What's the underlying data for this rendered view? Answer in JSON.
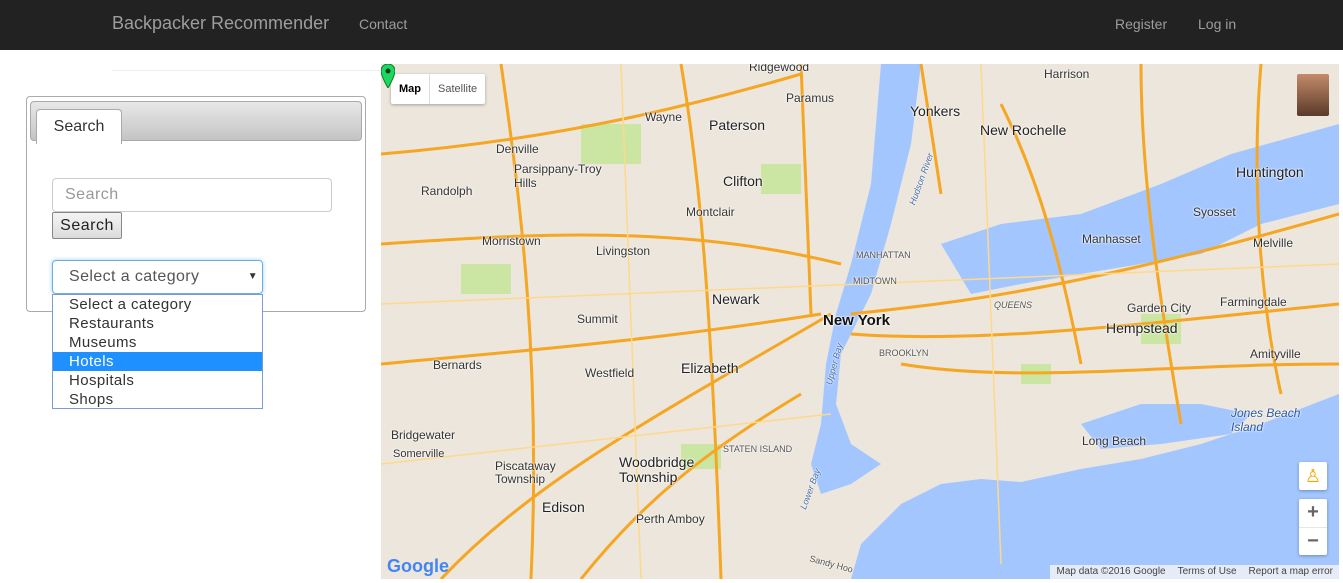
{
  "navbar": {
    "brand": "Backpacker Recommender",
    "contact": "Contact",
    "register": "Register",
    "login": "Log in"
  },
  "sidebar": {
    "tab_label": "Search",
    "search_placeholder": "Search",
    "search_button": "Search",
    "select_value": "Select a category",
    "category_options": [
      "Select a category",
      "Restaurants",
      "Museums",
      "Hotels",
      "Hospitals",
      "Shops"
    ],
    "highlighted_option": "Hotels"
  },
  "map": {
    "type_map": "Map",
    "type_satellite": "Satellite",
    "logo": "Google",
    "footer": {
      "data": "Map data ©2016 Google",
      "terms": "Terms of Use",
      "report": "Report a map error"
    },
    "zoom_in": "+",
    "zoom_out": "−",
    "labels": {
      "ridgewood": "Ridgewood",
      "paramus": "Paramus",
      "wayne": "Wayne",
      "paterson": "Paterson",
      "yonkers": "Yonkers",
      "new_rochelle": "New Rochelle",
      "harrison": "Harrison",
      "denville": "Denville",
      "parsippany": "Parsippany-Troy\nHills",
      "clifton": "Clifton",
      "randolph": "Randolph",
      "montclair": "Montclair",
      "huntington": "Huntington",
      "syosset": "Syosset",
      "morristown": "Morristown",
      "livingston": "Livingston",
      "manhattan": "MANHATTAN",
      "manhasset": "Manhasset",
      "melville": "Melville",
      "midtown": "MIDTOWN",
      "newark": "Newark",
      "new_york": "New York",
      "queens": "QUEENS",
      "garden_city": "Garden City",
      "farmingdale": "Farmingdale",
      "summit": "Summit",
      "hempstead": "Hempstead",
      "brooklyn": "BROOKLYN",
      "bernards": "Bernards",
      "westfield": "Westfield",
      "elizabeth": "Elizabeth",
      "amityville": "Amityville",
      "upper_bay": "Upper Bay",
      "jones_beach": "Jones Beach\nIsland",
      "bridgewater": "Bridgewater",
      "somerville": "Somerville",
      "staten_island": "STATEN ISLAND",
      "long_beach": "Long Beach",
      "piscataway": "Piscataway\nTownship",
      "woodbridge": "Woodbridge\nTownship",
      "lower_bay": "Lower Bay",
      "edison": "Edison",
      "perth_amboy": "Perth Amboy",
      "hudson_river": "Hudson River",
      "sandy_hook": "Sandy Hoo"
    }
  }
}
